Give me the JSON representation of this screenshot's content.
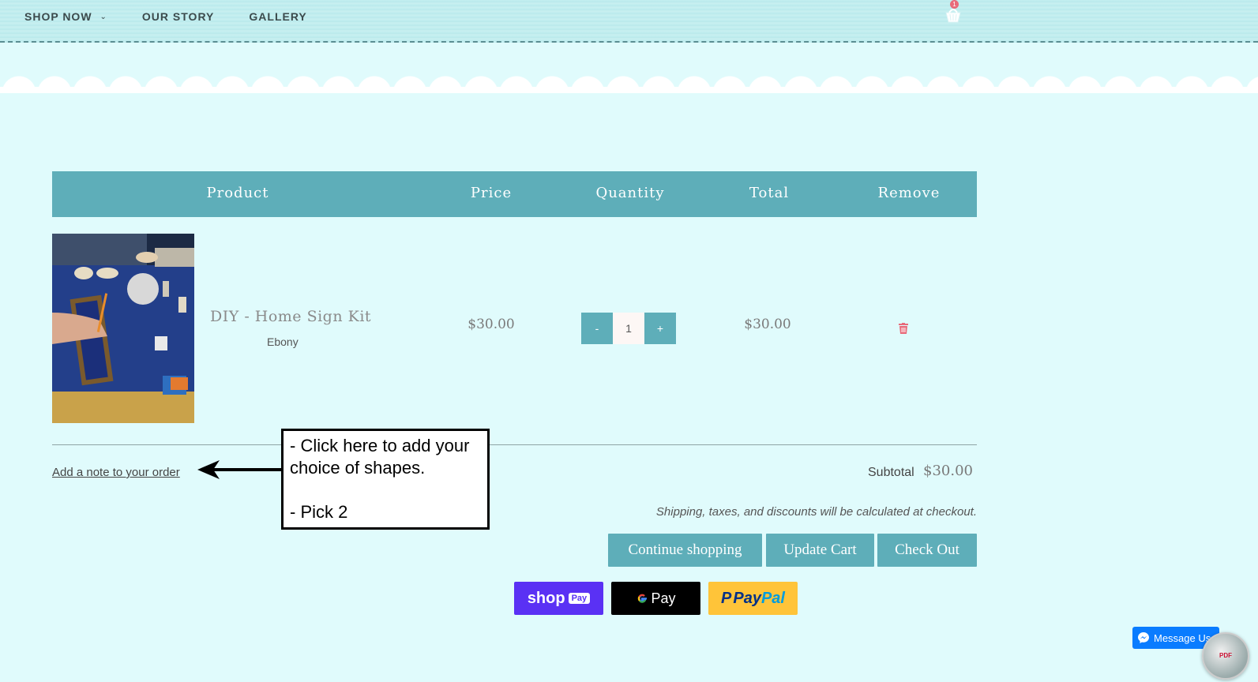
{
  "nav": {
    "items": [
      {
        "label": "SHOP NOW",
        "has_dropdown": true
      },
      {
        "label": "OUR STORY"
      },
      {
        "label": "GALLERY"
      }
    ],
    "cart_count": "1",
    "cart_icon": "basket-icon"
  },
  "table": {
    "headers": {
      "product": "Product",
      "price": "Price",
      "quantity": "Quantity",
      "total": "Total",
      "remove": "Remove"
    },
    "rows": [
      {
        "name": "DIY - Home Sign Kit",
        "variant": "Ebony",
        "price": "$30.00",
        "quantity": "1",
        "total": "$30.00",
        "remove_icon": "trash-icon"
      }
    ]
  },
  "qty": {
    "minus": "-",
    "plus": "+"
  },
  "note": {
    "link": "Add a note to your order"
  },
  "callout": {
    "text": "- Click here to add your choice of shapes.\n\n- Pick 2"
  },
  "summary": {
    "subtotal_label": "Subtotal",
    "subtotal_value": "$30.00",
    "shipping_note": "Shipping, taxes, and discounts will be calculated at checkout."
  },
  "buttons": {
    "continue": "Continue shopping",
    "update": "Update Cart",
    "checkout": "Check Out"
  },
  "payments": {
    "shop": "shop",
    "shop_tag": "Pay",
    "google": "Pay",
    "paypal_pay": "Pay",
    "paypal_pal": "Pal"
  },
  "messenger": {
    "label": "Message Us"
  },
  "badge": {
    "label": "PDF"
  },
  "colors": {
    "page_bg": "#e0fbfc",
    "accent": "#5eaeb9",
    "cart_badge": "#e86a7a",
    "trash": "#e86a7a",
    "shop_pay": "#5a31f4",
    "paypal": "#ffc439",
    "messenger": "#0a7cff"
  }
}
